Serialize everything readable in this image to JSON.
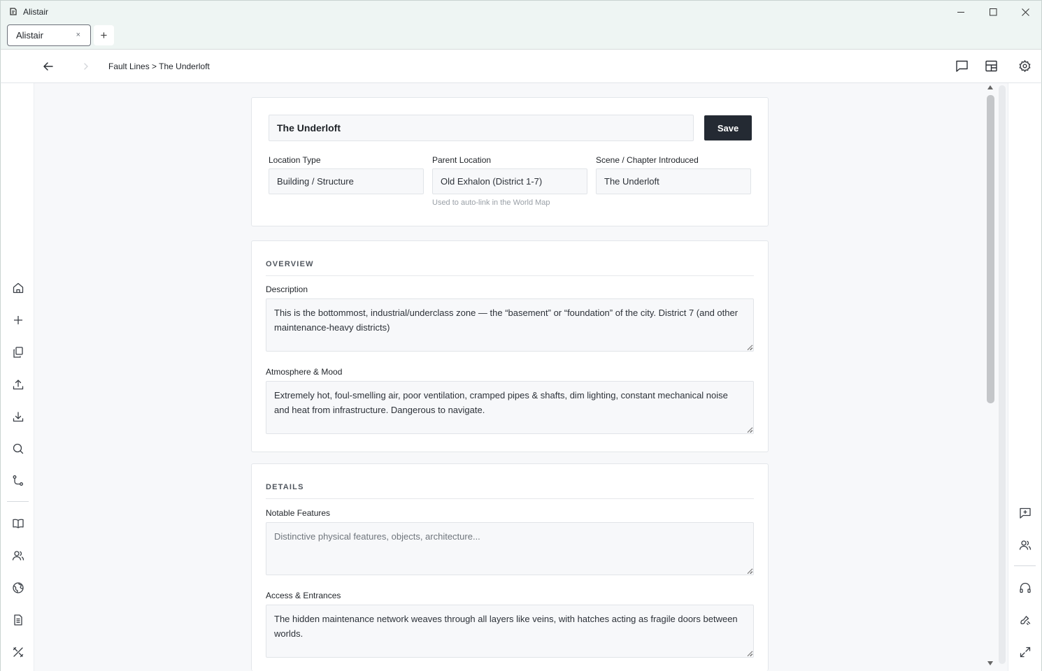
{
  "window": {
    "title": "Alistair"
  },
  "tabs": [
    {
      "label": "Alistair",
      "close": "×"
    }
  ],
  "new_tab_label": "+",
  "breadcrumb": "Fault Lines > The Underloft",
  "location": {
    "name": "The Underloft",
    "save_label": "Save",
    "fields": {
      "type": {
        "label": "Location Type",
        "value": "Building / Structure"
      },
      "parent": {
        "label": "Parent Location",
        "value": "Old Exhalon (District 1-7)",
        "hint": "Used to auto-link in the World Map"
      },
      "scene": {
        "label": "Scene / Chapter Introduced",
        "value": "The Underloft"
      }
    }
  },
  "overview": {
    "header": "OVERVIEW",
    "description": {
      "label": "Description",
      "value": "This is the bottommost, industrial/underclass zone — the “basement” or “foundation” of the city. District 7 (and other maintenance-heavy districts)"
    },
    "atmosphere": {
      "label": "Atmosphere & Mood",
      "value": "Extremely hot, foul-smelling air, poor ventilation, cramped pipes & shafts, dim lighting, constant mechanical noise and heat from infrastructure. Dangerous to navigate."
    }
  },
  "details": {
    "header": "DETAILS",
    "notable": {
      "label": "Notable Features",
      "placeholder": "Distinctive physical features, objects, architecture..."
    },
    "access": {
      "label": "Access & Entrances",
      "value": "The hidden maintenance network weaves through all layers like veins, with hatches acting as fragile doors between worlds."
    }
  }
}
